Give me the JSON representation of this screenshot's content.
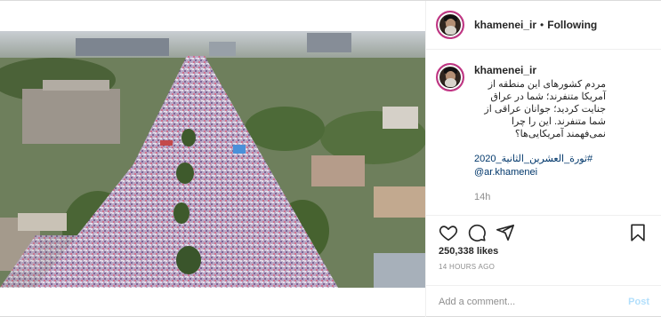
{
  "header": {
    "username": "khamenei_ir",
    "separator": "•",
    "follow_state": "Following"
  },
  "caption": {
    "username": "khamenei_ir",
    "text": "مردم کشورهای این منطقه از آمریکا متنفرند؛ شما در عراق جنایت کردید؛ جوانان عراقی از شما متنفرند. این را چرا نمی‌فهمند آمریکایی‌ها؟",
    "hashtag": "#ثورة_العشرين_الثانية_2020",
    "mention": "@ar.khamenei",
    "time": "14h"
  },
  "actions": {
    "like_icon": "heart-icon",
    "comment_icon": "comment-icon",
    "share_icon": "share-icon",
    "save_icon": "bookmark-icon"
  },
  "likes": "250,338 likes",
  "timestamp": "14 HOURS AGO",
  "comment_box": {
    "placeholder": "Add a comment...",
    "post_label": "Post"
  },
  "colors": {
    "link": "#00376b",
    "muted": "#8e8e8e",
    "post_disabled": "#b2dffc",
    "border": "#dbdbdb"
  }
}
